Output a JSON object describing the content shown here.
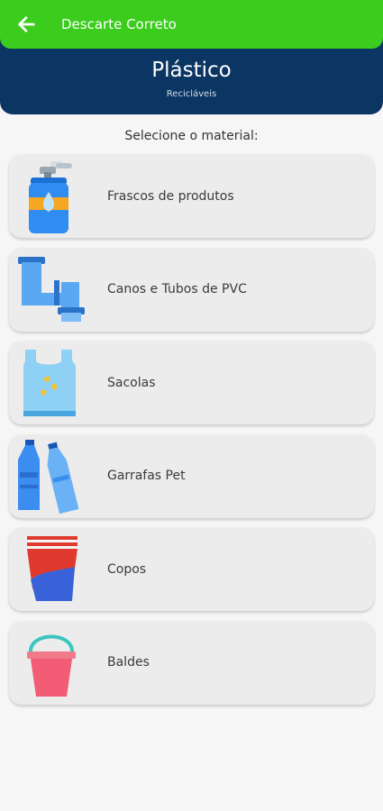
{
  "appbar": {
    "title": "Descarte Correto",
    "back_icon": "arrow-left-icon",
    "color": "#3bcc1e"
  },
  "header": {
    "title": "Plástico",
    "subtitle": "Recicláveis",
    "color": "#0b3563"
  },
  "prompt": "Selecione o material:",
  "materials": [
    {
      "label": "Frascos de produtos",
      "icon": "spray-bottle-icon"
    },
    {
      "label": "Canos e Tubos de PVC",
      "icon": "pvc-pipe-icon"
    },
    {
      "label": "Sacolas",
      "icon": "plastic-bag-icon"
    },
    {
      "label": "Garrafas Pet",
      "icon": "pet-bottles-icon"
    },
    {
      "label": "Copos",
      "icon": "cups-icon"
    },
    {
      "label": "Baldes",
      "icon": "bucket-icon"
    }
  ]
}
